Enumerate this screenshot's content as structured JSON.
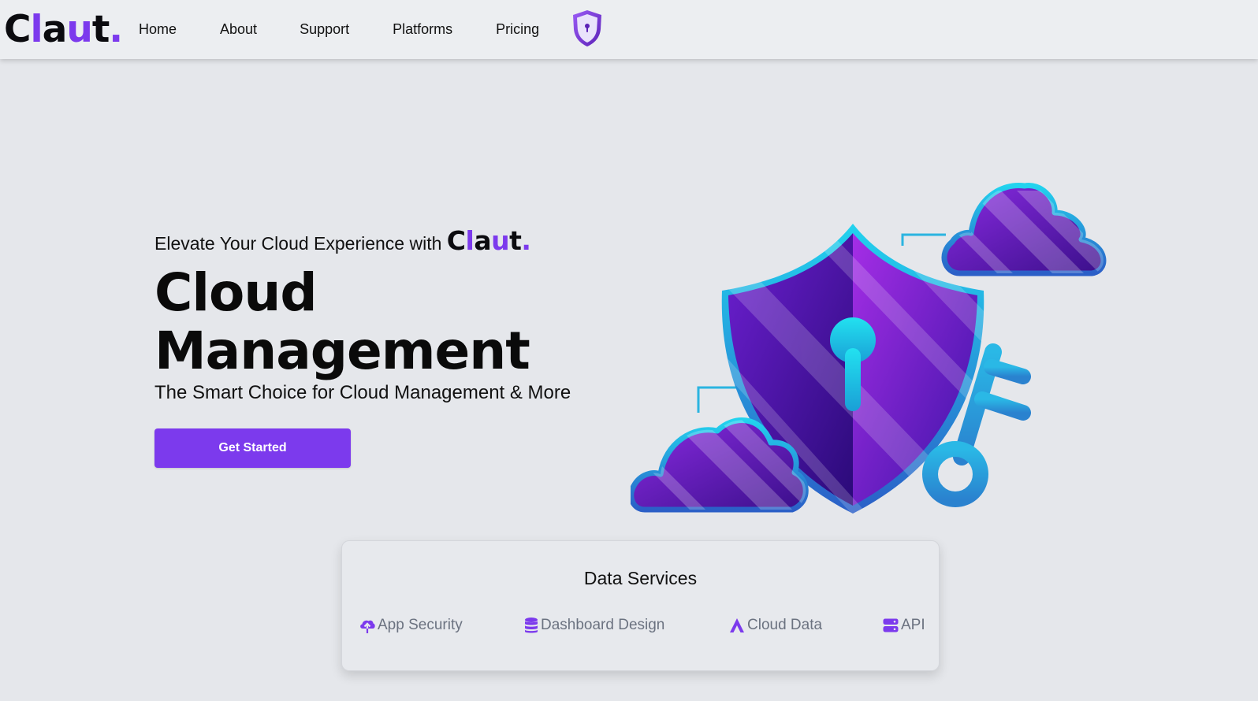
{
  "brand": {
    "logo_parts": [
      "C",
      "l",
      "a",
      "u",
      "t",
      "."
    ],
    "accent_color": "#7c3aed",
    "dark_color": "#0b0b0f"
  },
  "nav": {
    "items": [
      {
        "label": "Home"
      },
      {
        "label": "About"
      },
      {
        "label": "Support"
      },
      {
        "label": "Platforms"
      },
      {
        "label": "Pricing"
      }
    ],
    "icon": "shield-lock-icon"
  },
  "hero": {
    "tagline": "Elevate Your Cloud Experience with",
    "title_line1": "Cloud",
    "title_line2": "Management",
    "subtitle": "The Smart Choice for Cloud Management & More",
    "cta_label": "Get Started",
    "illustration": "shield-keyhole-clouds-key-illustration"
  },
  "services": {
    "title": "Data Services",
    "items": [
      {
        "label": "App Security",
        "icon": "cloud-upload-icon"
      },
      {
        "label": "Dashboard Design",
        "icon": "database-icon"
      },
      {
        "label": "Cloud Data",
        "icon": "a-letter-icon"
      },
      {
        "label": "API",
        "icon": "server-icon"
      }
    ]
  }
}
